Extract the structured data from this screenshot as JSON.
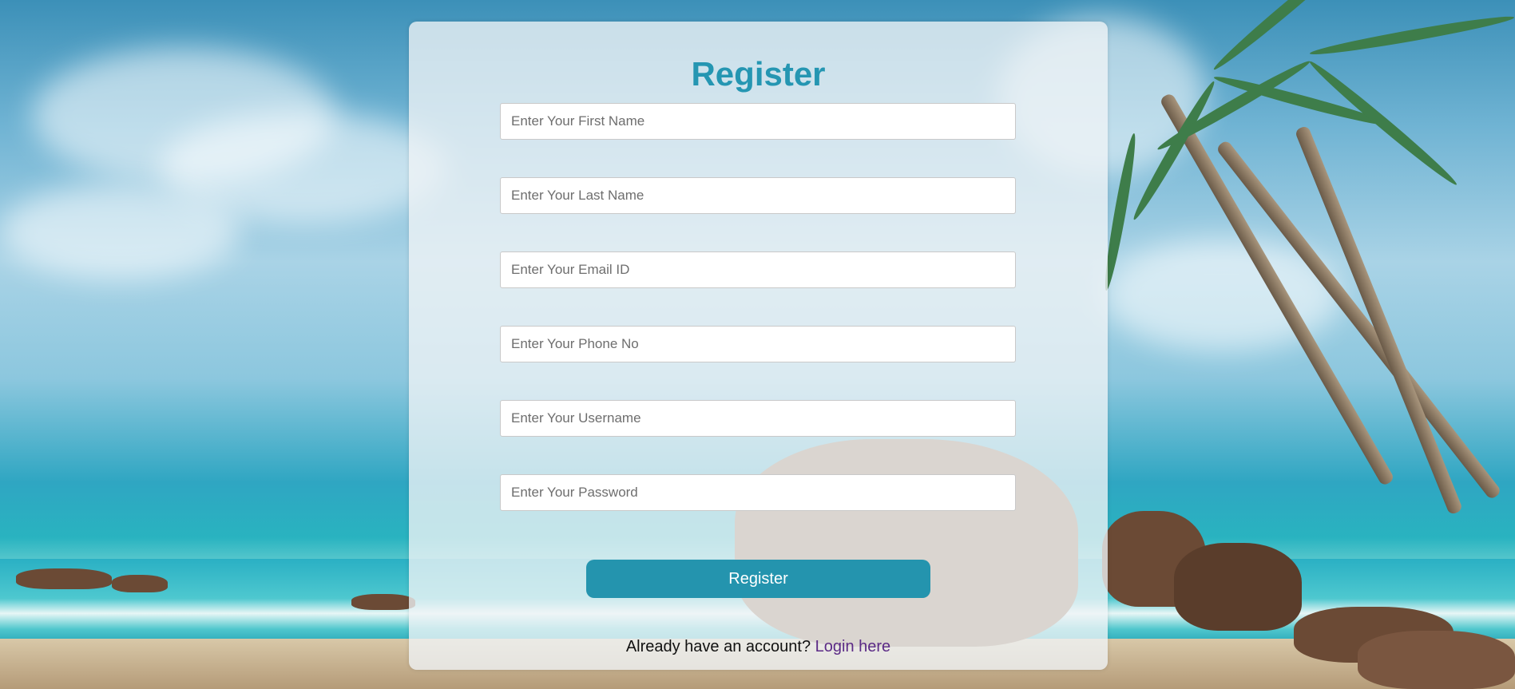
{
  "form": {
    "title": "Register",
    "fields": [
      {
        "placeholder": "Enter Your First Name",
        "value": ""
      },
      {
        "placeholder": "Enter Your Last Name",
        "value": ""
      },
      {
        "placeholder": "Enter Your Email ID",
        "value": ""
      },
      {
        "placeholder": "Enter Your Phone No",
        "value": ""
      },
      {
        "placeholder": "Enter Your Username",
        "value": ""
      },
      {
        "placeholder": "Enter Your Password",
        "value": ""
      }
    ],
    "submit_label": "Register",
    "footer_text": "Already have an account?",
    "login_link": "Login here"
  },
  "colors": {
    "accent": "#2596b2",
    "button": "#2494ae",
    "link": "#5b2a86"
  }
}
